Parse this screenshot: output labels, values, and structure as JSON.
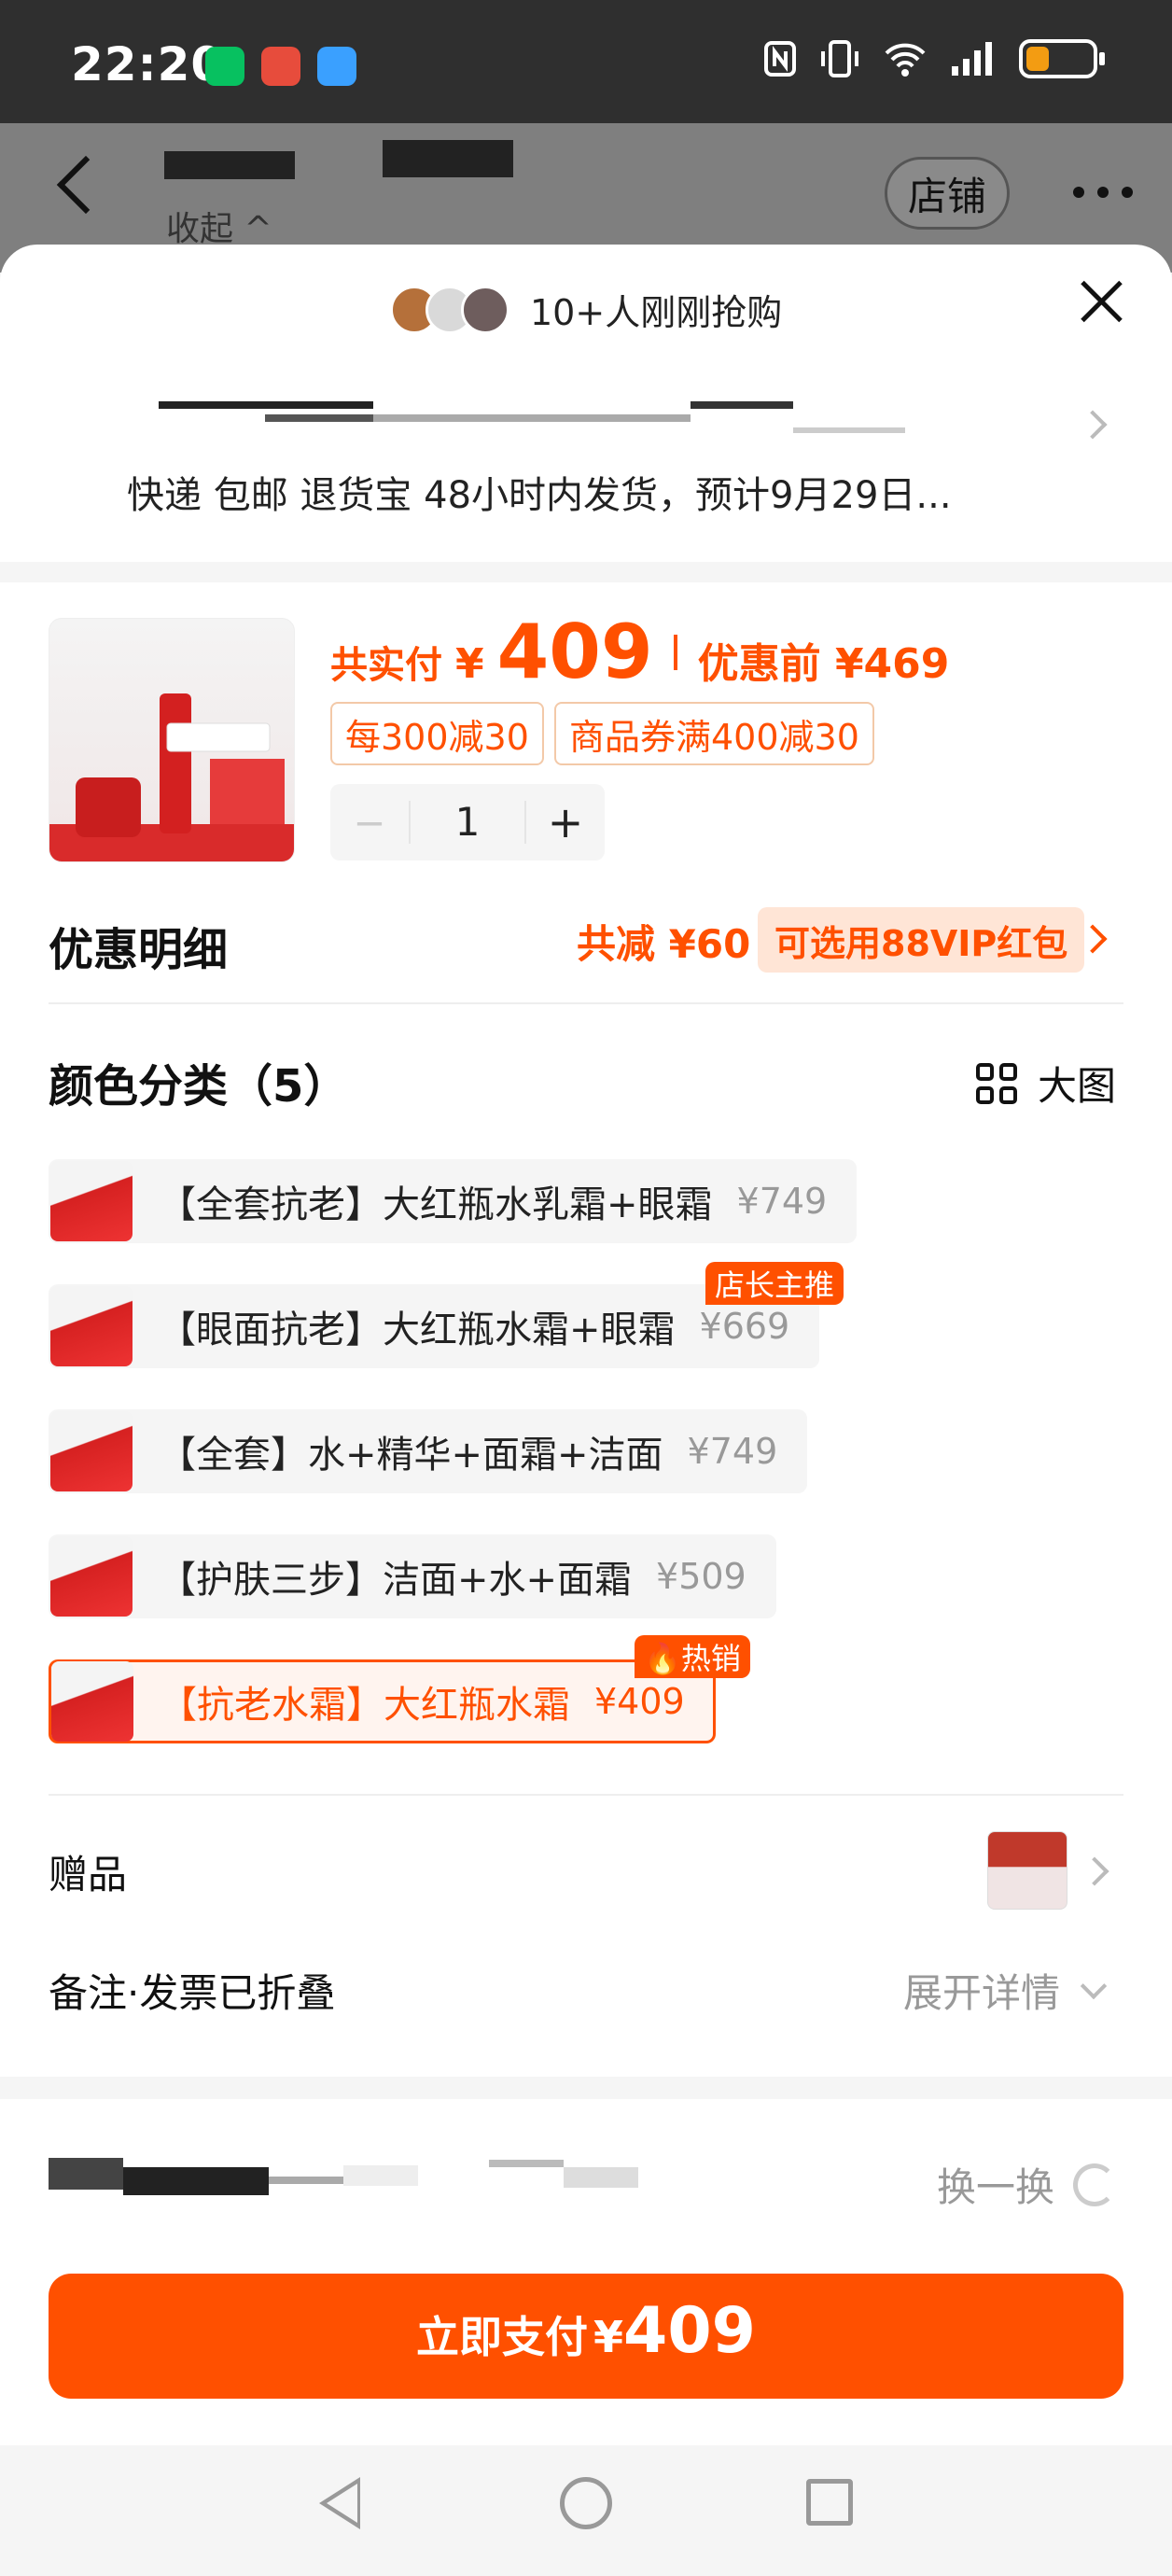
{
  "status_bar": {
    "time": "22:20"
  },
  "header": {
    "collapse_label": "收起 ^",
    "store_label": "店铺"
  },
  "sheet": {
    "buyers_text": "10+人刚刚抢购",
    "shipping_text": "快递 包邮 退货宝 48小时内发货，预计9月29日..."
  },
  "product": {
    "paid_label": "共实付",
    "currency": "¥",
    "price": "409",
    "orig_label": "优惠前 ¥469",
    "coupons": [
      "每300减30",
      "商品券满400减30"
    ],
    "quantity": "1",
    "minus": "−",
    "plus": "+"
  },
  "discount": {
    "title": "优惠明细",
    "total": "共减 ¥60",
    "vip_label": "可选用88VIP红包"
  },
  "sku_section": {
    "title": "颜色分类（5）",
    "big_view": "大图",
    "items": [
      {
        "name": "【全套抗老】大红瓶水乳霜+眼霜",
        "price": "¥749",
        "badge": ""
      },
      {
        "name": "【眼面抗老】大红瓶水霜+眼霜",
        "price": "¥669",
        "badge": "店长主推"
      },
      {
        "name": "【全套】水+精华+面霜+洁面",
        "price": "¥749",
        "badge": ""
      },
      {
        "name": "【护肤三步】洁面+水+面霜",
        "price": "¥509",
        "badge": ""
      },
      {
        "name": "【抗老水霜】大红瓶水霜",
        "price": "¥409",
        "badge": "🔥热销"
      }
    ],
    "selected_index": 4
  },
  "gift": {
    "label": "赠品"
  },
  "note": {
    "label": "备注·发票已折叠",
    "expand_label": "展开详情"
  },
  "recommend": {
    "swap_label": "换一换"
  },
  "pay": {
    "label": "立即支付",
    "currency": "¥",
    "price": "409"
  },
  "colors": {
    "accent": "#ff5000",
    "statusbar": "#2f2f2f"
  },
  "icons": [
    "back-arrow-icon",
    "more-icon",
    "close-icon",
    "grid-icon",
    "refresh-icon",
    "chevron-right-icon",
    "chevron-down-icon"
  ]
}
